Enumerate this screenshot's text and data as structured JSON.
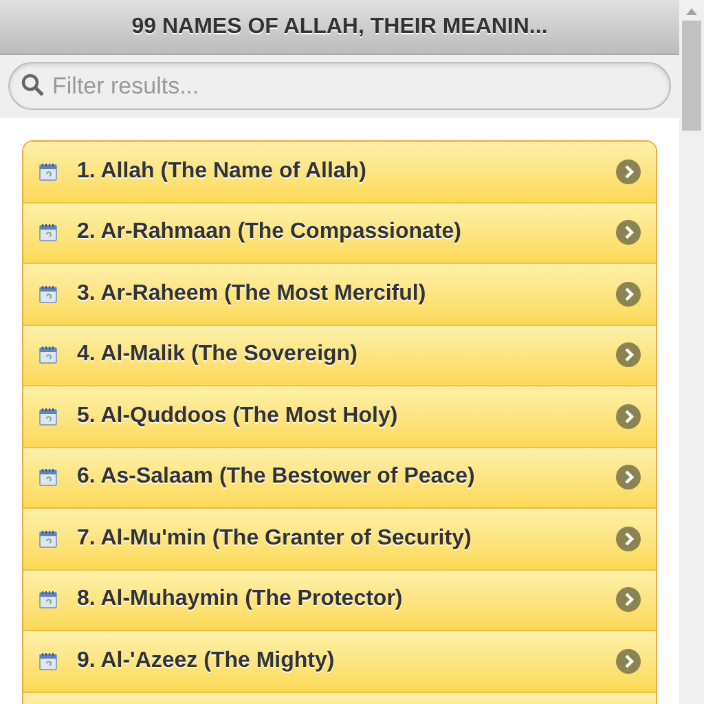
{
  "header": {
    "title": "99 NAMES OF ALLAH, THEIR MEANIN..."
  },
  "search": {
    "placeholder": "Filter results..."
  },
  "items": [
    {
      "label": "1. Allah (The Name of Allah)"
    },
    {
      "label": "2. Ar-Rahmaan (The Compassionate)"
    },
    {
      "label": "3. Ar-Raheem (The Most Merciful)"
    },
    {
      "label": "4. Al-Malik (The Sovereign)"
    },
    {
      "label": "5. Al-Quddoos (The Most Holy)"
    },
    {
      "label": "6. As-Salaam (The Bestower of Peace)"
    },
    {
      "label": "7. Al-Mu'min (The Granter of Security)"
    },
    {
      "label": "8. Al-Muhaymin (The Protector)"
    },
    {
      "label": "9. Al-'Azeez (The Mighty)"
    }
  ]
}
